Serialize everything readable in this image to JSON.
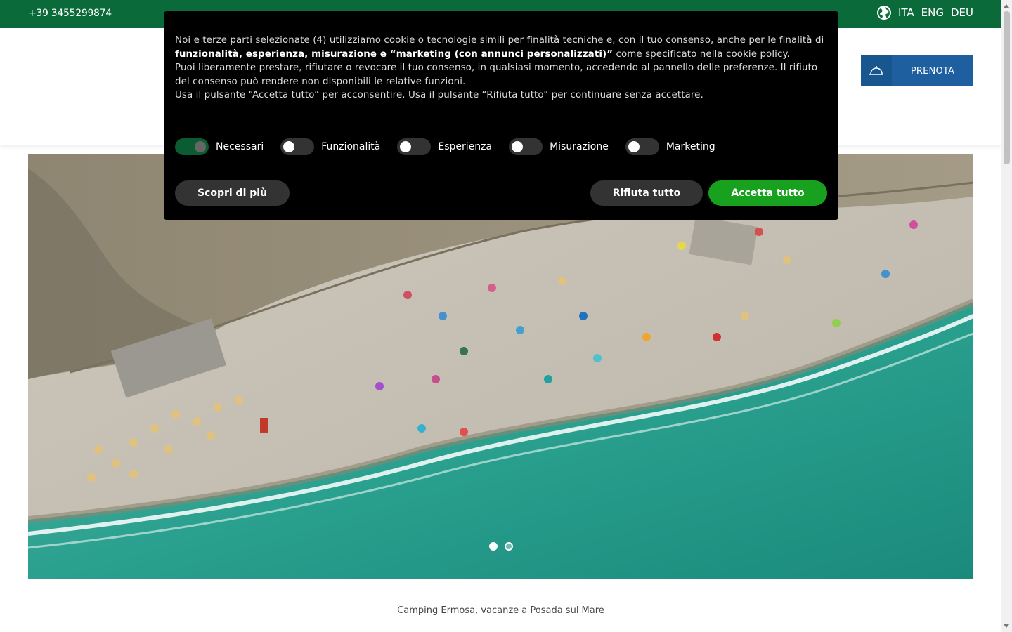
{
  "topbar": {
    "phone": "+39 3455299874",
    "globe_icon": "globe-icon",
    "languages": [
      "ITA",
      "ENG",
      "DEU"
    ]
  },
  "header": {
    "book_button_label": "PRENOTA",
    "book_icon": "reception-bell-icon"
  },
  "hero": {
    "slides_count": 2,
    "active_slide": 1
  },
  "caption": "Camping Ermosa, vacanze a Posada sul Mare",
  "cookie_banner": {
    "intro_1": "Noi e terze parti selezionate (4) utilizziamo cookie o tecnologie simili per finalità tecniche e, con il tuo consenso, anche per le finalità di ",
    "intro_bold": "funzionalità, esperienza, misurazione e “marketing (con annunci personalizzati)”",
    "intro_2": " come specificato nella ",
    "policy_link": "cookie policy",
    "intro_3": ".",
    "line_2": "Puoi liberamente prestare, rifiutare o revocare il tuo consenso, in qualsiasi momento, accedendo al pannello delle preferenze. Il rifiuto del consenso può rendere non disponibili le relative funzioni.",
    "line_3": "Usa il pulsante “Accetta tutto” per acconsentire. Usa il pulsante “Rifiuta tutto” per continuare senza accettare.",
    "toggles": [
      {
        "label": "Necessari",
        "on": true
      },
      {
        "label": "Funzionalità",
        "on": false
      },
      {
        "label": "Esperienza",
        "on": false
      },
      {
        "label": "Misurazione",
        "on": false
      },
      {
        "label": "Marketing",
        "on": false
      }
    ],
    "learn_more_label": "Scopri di più",
    "reject_label": "Rifiuta tutto",
    "accept_label": "Accetta tutto",
    "colors": {
      "accept": "#17a11e",
      "background": "#000000"
    }
  }
}
